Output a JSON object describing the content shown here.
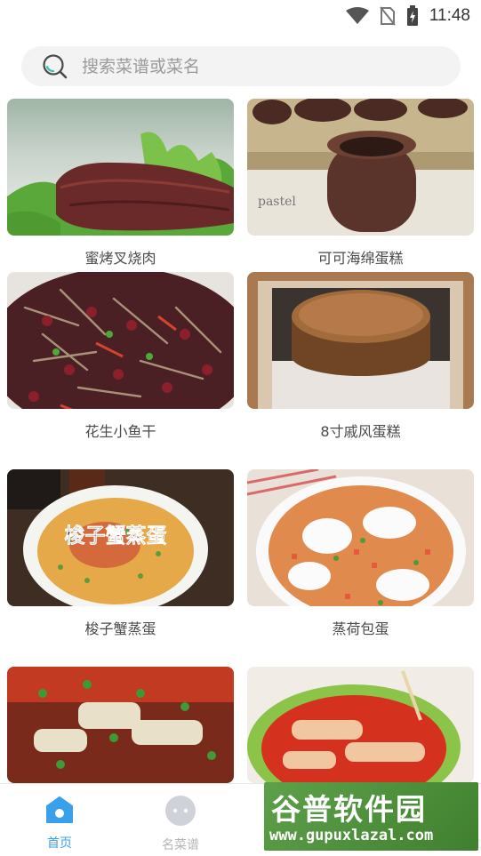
{
  "status_bar": {
    "time": "11:48"
  },
  "search": {
    "placeholder": "搜索菜谱或菜名"
  },
  "recipes": [
    {
      "name": "蜜烤叉烧肉"
    },
    {
      "name": "可可海绵蛋糕"
    },
    {
      "name": "花生小鱼干"
    },
    {
      "name": "8寸戚风蛋糕"
    },
    {
      "name": "梭子蟹蒸蛋",
      "overlay_text": "梭子蟹蒸蛋"
    },
    {
      "name": "蒸荷包蛋"
    },
    {
      "name": ""
    },
    {
      "name": ""
    }
  ],
  "bottom_nav": {
    "items": [
      {
        "label": "首页",
        "icon": "home-icon",
        "active": true
      },
      {
        "label": "名菜谱",
        "icon": "chat-icon",
        "active": false
      }
    ]
  },
  "watermark": {
    "title": "谷普软件园",
    "url": "www.gupuxlazal.com"
  },
  "colors": {
    "accent": "#3aa0ec",
    "watermark_green": "#4e9340"
  }
}
